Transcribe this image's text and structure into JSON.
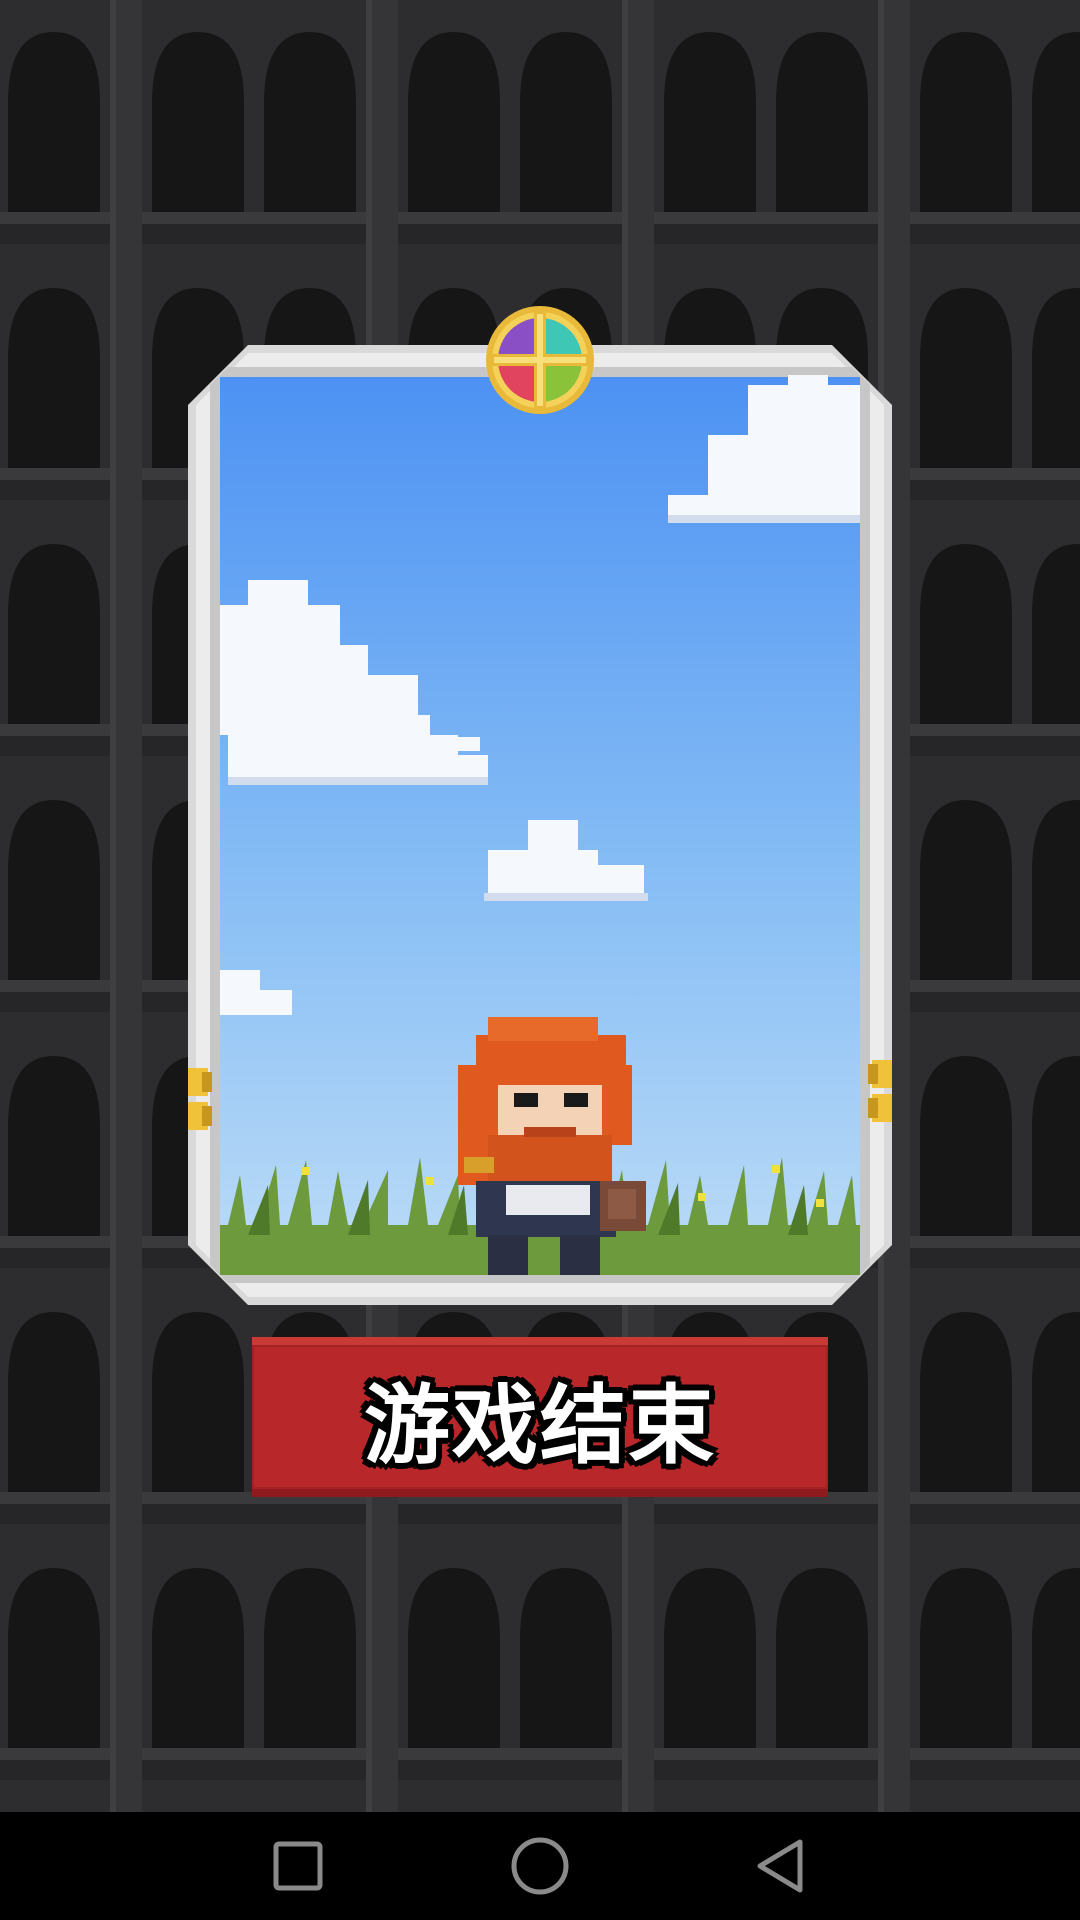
{
  "game_over": {
    "label": "游戏结束"
  },
  "colors": {
    "button_red": "#b8272a",
    "sky_top": "#4d92f3",
    "sky_bottom": "#bcdcf7",
    "frame_silver": "#dcdcdc",
    "hair_orange": "#e05a20",
    "grass_green": "#6c9a3c"
  },
  "icons": {
    "emblem": "four-gem-emblem",
    "nav_recent": "square-icon",
    "nav_home": "circle-icon",
    "nav_back": "triangle-back-icon"
  }
}
